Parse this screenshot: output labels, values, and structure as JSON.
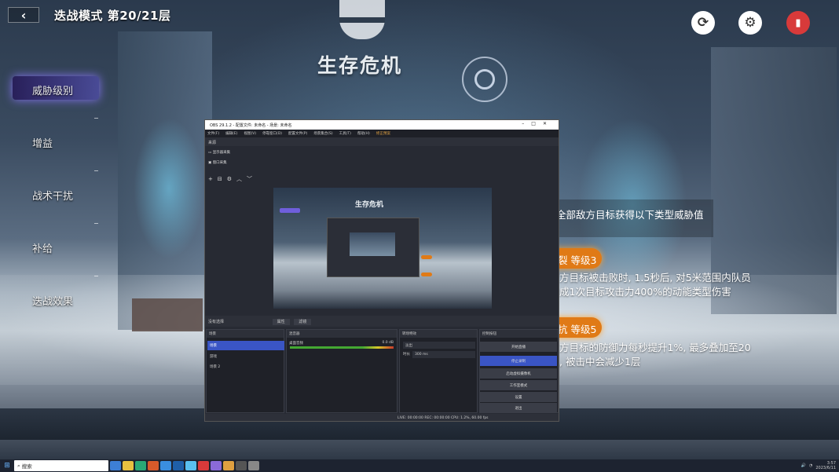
{
  "game": {
    "title": "迭战模式  第20/21层",
    "logo_text": "生存危机",
    "nav": [
      {
        "label": "威胁级别",
        "active": true
      },
      {
        "label": "增益",
        "active": false
      },
      {
        "label": "战术干扰",
        "active": false
      },
      {
        "label": "补给",
        "active": false
      },
      {
        "label": "迭战效果",
        "active": false
      }
    ],
    "threat_intro": "全部敌方目标获得以下类型威胁值",
    "threats": [
      {
        "badge": "裂  等级3",
        "lines": [
          "方目标被击败时, 1.5秒后, 对5米范围内队员",
          "成1次目标攻击力400%的动能类型伤害"
        ]
      },
      {
        "badge": "抗  等级5",
        "lines": [
          "方目标的防御力每秒提升1%, 最多叠加至20",
          ", 被击中会减少1层"
        ]
      }
    ],
    "icons": [
      "refresh-icon",
      "gear-icon",
      "exit-icon"
    ]
  },
  "obs": {
    "title": "OBS 29.1.2 - 配置文件: 未命名 - 场景: 未命名",
    "menu": [
      "文件(F)",
      "编辑(E)",
      "视图(V)",
      "停靠窗口(D)",
      "配置文件(P)",
      "场景集合(S)",
      "工具(T)",
      "帮助(H)",
      "修正预案"
    ],
    "sources_header": "来源",
    "sources": [
      "显示器采集",
      "窗口采集"
    ],
    "preview_logo": "生存危机",
    "controls_bar": "没有选择",
    "controls_bar_buttons": [
      "属性",
      "滤镜"
    ],
    "scenes_header": "场景",
    "scenes": [
      "场景",
      "游戏",
      "场景 2"
    ],
    "mixer_header": "混音器",
    "mixer_track": "桌面音频",
    "mixer_db": "0.0 dB",
    "transitions_header": "转场特效",
    "transition_type": "淡出",
    "transition_duration_label": "时长",
    "transition_duration": "300 ms",
    "controls_header": "控制按钮",
    "control_buttons": [
      "开始直播",
      "停止录制",
      "启动虚拟摄像机",
      "工作室模式",
      "设置",
      "退出"
    ],
    "status": "LIVE: 00:00:00   REC: 00:00:00   CPU: 1.2%, 60.00 fps"
  },
  "taskbar": {
    "search_placeholder": "搜索",
    "time": "3:57",
    "date": "2023/6/11"
  },
  "colors": {
    "accent_orange": "#e07a16",
    "nav_active": "#6f5fdc",
    "exit_red": "#d83a3a",
    "obs_highlight": "#3a55c5"
  }
}
